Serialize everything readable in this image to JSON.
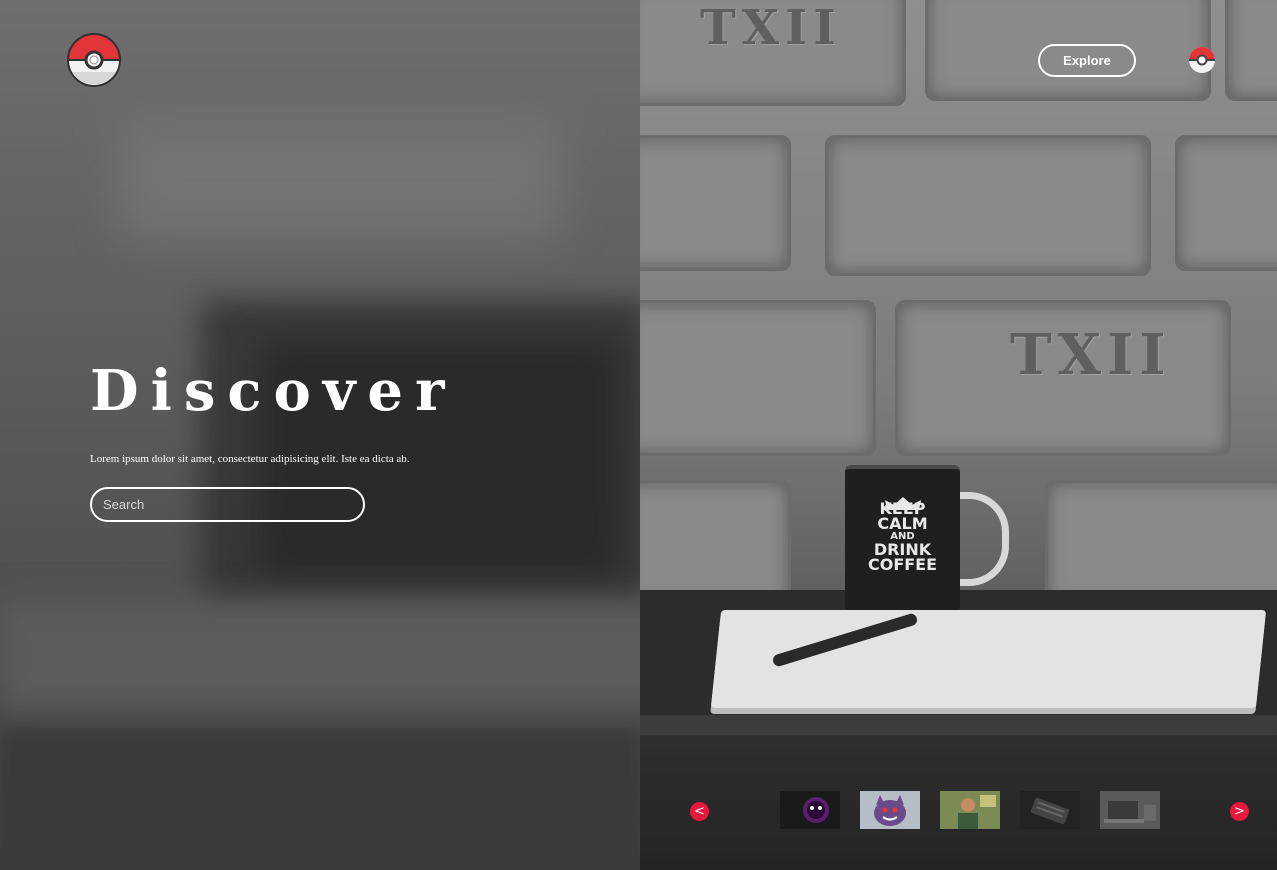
{
  "header": {
    "logo_icon": "pokeball-icon",
    "explore_label": "Explore",
    "profile_icon": "pokeball-icon"
  },
  "hero": {
    "title": "Discover",
    "subtitle": "Lorem ipsum dolor sit amet, consectetur adipisicing elit. Iste ea dicta ab.",
    "search_placeholder": "Search"
  },
  "background": {
    "mug_text": [
      "KEEP",
      "CALM",
      "AND",
      "DRINK",
      "COFFEE"
    ],
    "wall_carving": "TXII"
  },
  "carousel": {
    "prev_label": "<",
    "next_label": ">",
    "accent_color": "#e8173e",
    "thumbnails": [
      "gastly",
      "gengar",
      "person-photo",
      "keyboard",
      "laptop-desk"
    ]
  }
}
